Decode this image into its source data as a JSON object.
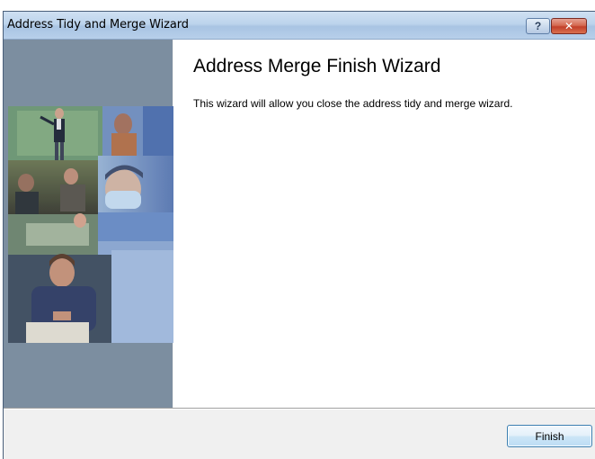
{
  "window": {
    "title": "Address Tidy and Merge Wizard",
    "help_glyph": "?",
    "close_glyph": "✕"
  },
  "wizard": {
    "heading": "Address Merge Finish Wizard",
    "description": "This wizard will allow you close the address tidy and merge wizard."
  },
  "footer": {
    "finish_label": "Finish"
  },
  "sidebar": {
    "image_icon": "wizard-collage-photo"
  },
  "colors": {
    "sidebar_bg": "#7c8ea0",
    "close_button": "#c2402a",
    "title_bar": "#bcd3ec"
  }
}
